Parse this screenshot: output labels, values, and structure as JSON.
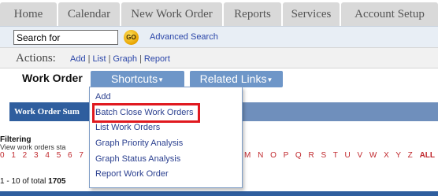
{
  "tabs": [
    "Home",
    "Calendar",
    "New Work Order",
    "Reports",
    "Services",
    "Account Setup"
  ],
  "search": {
    "value": "Search for",
    "go_label": "GO",
    "advanced_label": "Advanced Search"
  },
  "actions": {
    "label": "Actions:",
    "links": [
      "Add",
      "List",
      "Graph",
      "Report"
    ]
  },
  "work_order": {
    "title": "Work Order",
    "shortcuts_label": "Shortcuts",
    "related_label": "Related Links"
  },
  "summary": {
    "title": "Work Order Sum"
  },
  "filtering": {
    "title": "Filtering",
    "description": "View work orders sta",
    "numbers": "0 1 2 3 4 5 6 7",
    "letters": "M N O P Q R S T U V W X Y Z",
    "all_label": "ALL"
  },
  "total": {
    "prefix": "1 - 10 of total",
    "count": "1705"
  },
  "shortcuts_menu": {
    "items": [
      "Add",
      "Batch Close Work Orders",
      "List Work Orders",
      "Graph Priority Analysis",
      "Graph Status Analysis",
      "Report Work Order"
    ],
    "highlighted_index": 1
  },
  "colors": {
    "accent": "#6e96c8",
    "highlight": "#e0191f",
    "link": "#2a45a8"
  }
}
